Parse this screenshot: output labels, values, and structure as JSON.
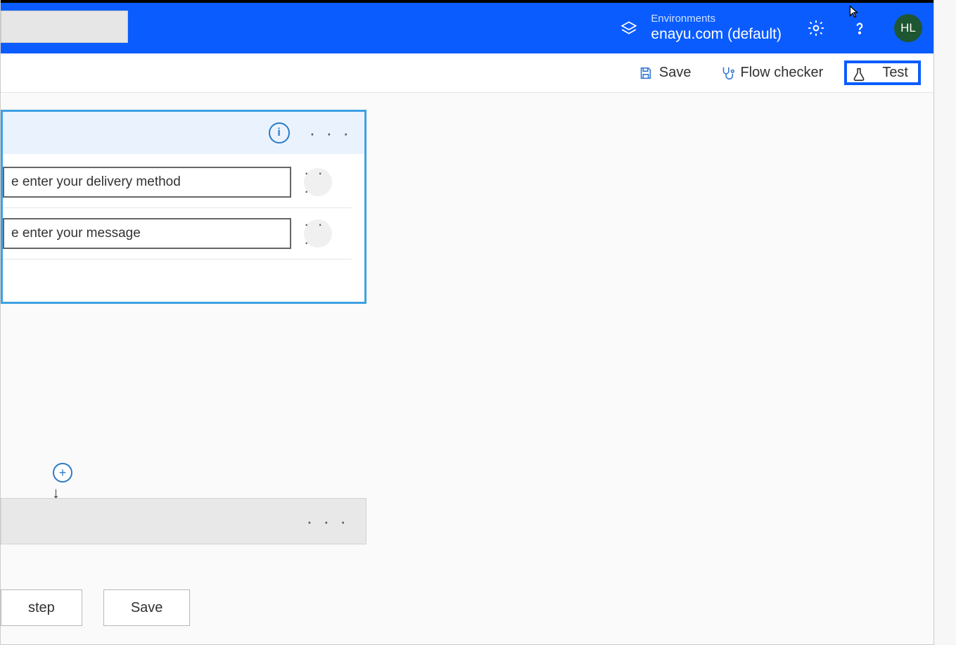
{
  "header": {
    "environments_label": "Environments",
    "environment_name": "enayu.com (default)",
    "avatar_initials": "HL"
  },
  "subbar": {
    "save_label": "Save",
    "flow_checker_label": "Flow checker",
    "test_label": "Test"
  },
  "trigger_card": {
    "info_symbol": "i",
    "more_symbol": "· · ·",
    "input1_value": "e enter your delivery method",
    "input2_value": "e enter your message"
  },
  "placeholder_step": {
    "more_symbol": "· · ·"
  },
  "connector": {
    "plus_symbol": "+",
    "arrow_symbol": "↓"
  },
  "bottom": {
    "step_label": "step",
    "save_label": "Save"
  }
}
